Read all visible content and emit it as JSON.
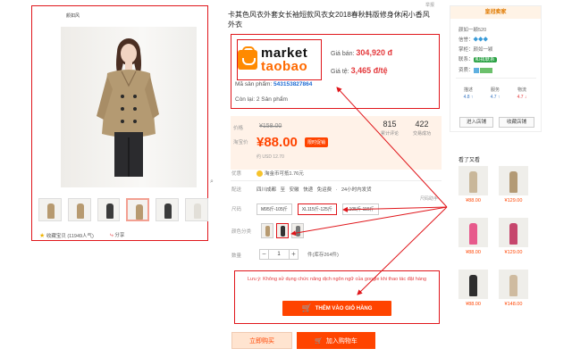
{
  "product": {
    "title": "卡其色风衣外套女长袖短款风衣女2018春秋韩版修身休闲小香风外衣",
    "report": "举报"
  },
  "gallery": {
    "store_badge": "颜如风",
    "favorites": "收藏宝贝 (11949人气)",
    "share": "分享",
    "thumbnails": [
      "thumb-1",
      "thumb-2",
      "thumb-3",
      "thumb-4",
      "thumb-5",
      "thumb-6"
    ],
    "active_thumb": 3
  },
  "extension": {
    "brand_top": "market",
    "brand_bottom": "taobao",
    "price_vnd_label": "Giá bán:",
    "price_vnd": "304,920 đ",
    "rate_label": "Giá tệ:",
    "rate": "3,465 đ/tệ",
    "sku_label": "Mã sản phẩm:",
    "sku": "543153827864",
    "stock_label": "Còn lại:",
    "stock": "2 Sản phẩm",
    "notice": "Lưu ý: Không sử dụng chức năng dịch ngôn ngữ của google khi thao tác đặt hàng",
    "add_button": "THÊM VÀO GIỎ HÀNG"
  },
  "pricing": {
    "price_label": "价格",
    "old_price": "¥158.00",
    "promo_label": "淘宝价",
    "price": "¥88.00",
    "promo_badge": "限时促销",
    "usd": "约 USD 12.70",
    "reviews_count": "815",
    "reviews_label": "累计评论",
    "sales_count": "422",
    "sales_label": "交易成功"
  },
  "perks": {
    "label": "优惠",
    "points": "淘金币可抵1.76元"
  },
  "shipping": {
    "label": "配送",
    "text": "四川成都 至 安徽 快递 免运费 · 24小时内发货",
    "size_guide": "尺码助手"
  },
  "size": {
    "label": "尺码",
    "options": [
      "M95斤-105斤",
      "XL115斤-125斤",
      "L105斤-115斤"
    ],
    "selected": 1
  },
  "colors": {
    "label": "颜色分类",
    "selected": 1
  },
  "quantity": {
    "label": "数量",
    "value": "1",
    "minus": "−",
    "plus": "+",
    "stock": "件(库存264件)"
  },
  "actions": {
    "buy_now": "立即购买",
    "add_cart": "加入购物车"
  },
  "shop": {
    "header": "皇冠卖家",
    "name": "颜如一颖520",
    "credit_label": "信誉：",
    "company_label": "掌柜：",
    "company": "颜如一颖",
    "contact_label": "联系：",
    "contact": "和我联系",
    "qual_label": "资质：",
    "ratings": [
      {
        "label": "描述",
        "value": "4.8 ↑"
      },
      {
        "label": "服务",
        "value": "4.7 ↑"
      },
      {
        "label": "物流",
        "value": "4.7 ↓"
      }
    ],
    "enter": "进入店铺",
    "favorite": "收藏店铺"
  },
  "also_viewed": {
    "title": "看了又看",
    "prices": [
      "¥88.00",
      "¥129.00",
      "¥88.00",
      "¥129.00",
      "¥88.00",
      "¥148.00"
    ]
  },
  "colors_hex": {
    "accent": "#ff4400",
    "annotation_red": "#e0161b",
    "brand_orange": "#ff8a00",
    "price_bg": "#fff2e8"
  }
}
